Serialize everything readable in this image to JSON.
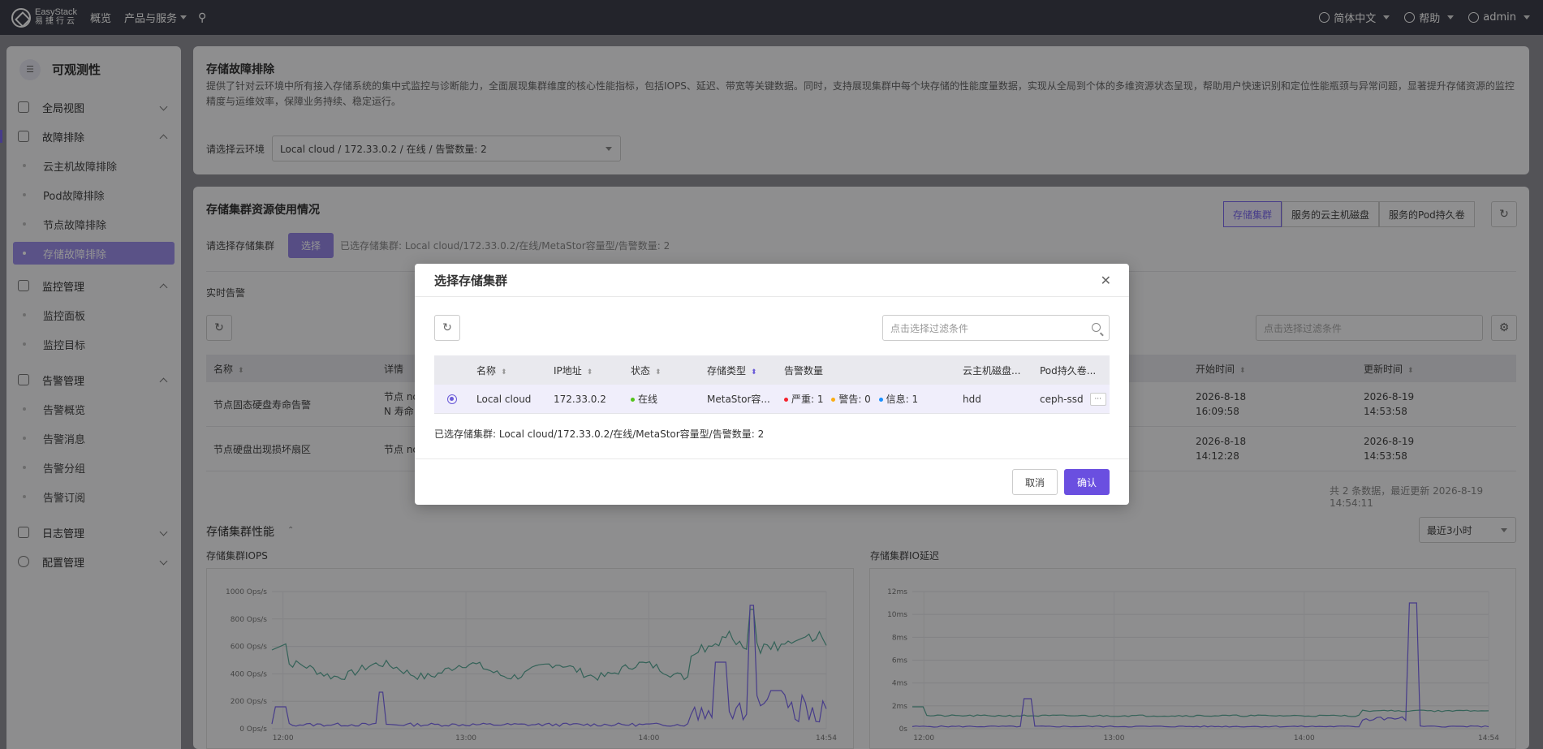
{
  "topbar": {
    "logo_en": "EasyStack",
    "logo_cn": "易捷行云",
    "nav": [
      "概览",
      "产品与服务"
    ],
    "language": "简体中文",
    "help": "帮助",
    "user": "admin"
  },
  "sidebar": {
    "title": "可观测性",
    "groups": [
      {
        "label": "全局视图",
        "expanded": false,
        "items": []
      },
      {
        "label": "故障排除",
        "expanded": true,
        "items": [
          "云主机故障排除",
          "Pod故障排除",
          "节点故障排除",
          "存储故障排除"
        ]
      },
      {
        "label": "监控管理",
        "expanded": true,
        "items": [
          "监控面板",
          "监控目标"
        ]
      },
      {
        "label": "告警管理",
        "expanded": true,
        "items": [
          "告警概览",
          "告警消息",
          "告警分组",
          "告警订阅"
        ]
      },
      {
        "label": "日志管理",
        "expanded": false,
        "items": []
      },
      {
        "label": "配置管理",
        "expanded": false,
        "items": []
      }
    ],
    "selected_item": "存储故障排除"
  },
  "panel1": {
    "title": "存储故障排除",
    "description": "提供了针对云环境中所有接入存储系统的集中式监控与诊断能力，全面展现集群维度的核心性能指标，包括IOPS、延迟、带宽等关键数据。同时，支持展现集群中每个块存储的性能度量数据，实现从全局到个体的多维资源状态呈现，帮助用户快速识别和定位性能瓶颈与异常问题，显著提升存储资源的监控精度与运维效率，保障业务持续、稳定运行。",
    "env_label": "请选择云环境",
    "env_value": "Local cloud / 172.33.0.2 / 在线 / 告警数量: 2"
  },
  "panel2": {
    "title": "存储集群资源使用情况",
    "tabs": [
      "存储集群",
      "服务的云主机磁盘",
      "服务的Pod持久卷"
    ],
    "active_tab": "存储集群",
    "cluster_label": "请选择存储集群",
    "select_button": "选择",
    "selected_text": "已选存储集群:  Local cloud/172.33.0.2/在线/MetaStor容量型/告警数量: 2",
    "alerts_title": "实时告警",
    "filter_placeholder": "点击选择过滤条件",
    "alert_columns": [
      "名称",
      "详情",
      "开始时间",
      "更新时间"
    ],
    "alert_rows": [
      {
        "name": "节点固态硬盘寿命告警",
        "detail_1": "节点 nc",
        "detail_2": "N 寿命",
        "start_date": "2026-8-18",
        "start_time": "16:09:58",
        "update_date": "2026-8-19",
        "update_time": "14:53:58"
      },
      {
        "name": "节点硬盘出现损坏扇区",
        "detail_1": "节点 nc",
        "detail_2": "",
        "start_date": "2026-8-18",
        "start_time": "14:12:28",
        "update_date": "2026-8-19",
        "update_time": "14:53:58"
      }
    ],
    "footer_text": "共 2 条数据，最近更新  2026-8-19 14:54:11",
    "perf_title": "存储集群性能",
    "time_range": "最近3小时"
  },
  "charts": {
    "iops": {
      "title": "存储集群IOPS",
      "y_ticks": [
        "1000 Ops/s",
        "800 Ops/s",
        "600 Ops/s",
        "400 Ops/s",
        "200 Ops/s",
        "0 Ops/s"
      ],
      "x_ticks": [
        "12:00",
        "13:00",
        "14:00",
        "14:54"
      ],
      "colors": {
        "series_a": "#5aaa98",
        "series_b": "#7b68ee"
      }
    },
    "latency": {
      "title": "存储集群IO延迟",
      "y_ticks": [
        "12ms",
        "10ms",
        "8ms",
        "6ms",
        "4ms",
        "2ms",
        "0s"
      ],
      "x_ticks": [
        "12:00",
        "13:00",
        "14:00",
        "14:54"
      ],
      "colors": {
        "series_a": "#5aaa98",
        "series_b": "#7b68ee"
      }
    }
  },
  "modal": {
    "title": "选择存储集群",
    "search_placeholder": "点击选择过滤条件",
    "columns": [
      "名称",
      "IP地址",
      "状态",
      "存储类型",
      "告警数量",
      "云主机磁盘...",
      "Pod持久卷..."
    ],
    "row": {
      "name": "Local cloud",
      "ip": "172.33.0.2",
      "status": "在线",
      "type": "MetaStor容...",
      "alert_critical": "严重: 1",
      "alert_warning": "警告: 0",
      "alert_info": "信息: 1",
      "vm_disk": "hdd",
      "pod_volume": "ceph-ssd"
    },
    "selected_text": "已选存储集群:  Local cloud/172.33.0.2/在线/MetaStor容量型/告警数量: 2",
    "cancel": "取消",
    "confirm": "确认"
  },
  "colors": {
    "accent": "#7b68ee",
    "status_online": "#52c41a",
    "critical": "#f5222d",
    "warning": "#faad14",
    "info": "#1890ff"
  }
}
